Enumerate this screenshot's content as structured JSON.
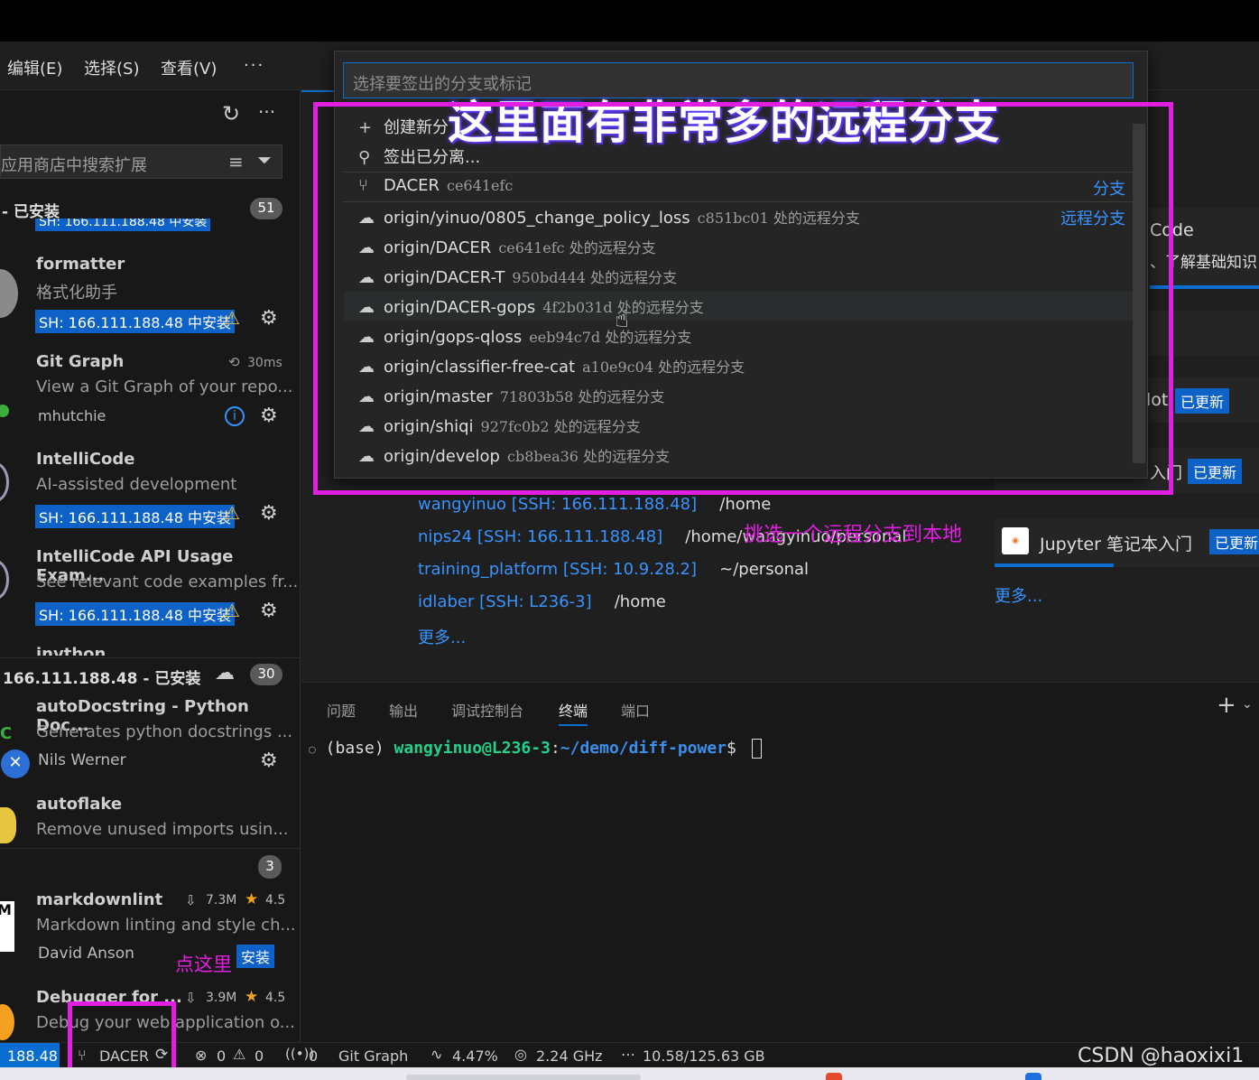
{
  "menu": {
    "edit": "编辑(E)",
    "select": "选择(S)",
    "view": "查看(V)",
    "more": "···"
  },
  "sidebar": {
    "search_placeholder": "应用商店中搜索扩展",
    "installed_header": "- 已安装",
    "installed_count": "51",
    "cut_item_text": "SH: 166.111.188.48 中安装",
    "installed_items": [
      {
        "name": "formatter",
        "desc": "格式化助手",
        "badge": "SH: 166.111.188.48 中安装"
      },
      {
        "name": "Git Graph",
        "desc": "View a Git Graph of your repo...",
        "publisher": "mhutchie",
        "time": "30ms"
      },
      {
        "name": "IntelliCode",
        "desc": "AI-assisted development",
        "badge": "SH: 166.111.188.48 中安装"
      },
      {
        "name": "IntelliCode API Usage Exam...",
        "desc": "See relevant code examples fr...",
        "badge": "SH: 166.111.188.48 中安装"
      },
      {
        "name": "invthon"
      }
    ],
    "remote_header": "166.111.188.48 - 已安装",
    "remote_count": "30",
    "remote_items": [
      {
        "name": "autoDocstring - Python Doc...",
        "desc": "Generates python docstrings ...",
        "publisher": "Nils Werner"
      },
      {
        "name": "autoflake",
        "desc": "Remove unused imports usin..."
      }
    ],
    "recommended_count": "3",
    "recommended_items": [
      {
        "name": "markdownlint",
        "downloads": "7.3M",
        "rating": "4.5",
        "desc": "Markdown linting and style ch...",
        "publisher": "David Anson",
        "install": "安装"
      },
      {
        "name": "Debugger for ...",
        "downloads": "3.9M",
        "rating": "4.5",
        "desc": "Debug your web application o..."
      }
    ]
  },
  "quickpick": {
    "placeholder": "选择要签出的分支或标记",
    "items": [
      {
        "icon": "+",
        "label": "创建新分",
        "desc": ""
      },
      {
        "icon": "⚲",
        "label": "签出已分离...",
        "desc": ""
      },
      {
        "icon": "⑂",
        "label": "DACER",
        "desc": "ce641efc",
        "tag": "分支"
      },
      {
        "icon": "☁",
        "label": "origin/yinuo/0805_change_policy_loss",
        "desc": "c851bc01 处的远程分支",
        "tag": "远程分支"
      },
      {
        "icon": "☁",
        "label": "origin/DACER",
        "desc": "ce641efc 处的远程分支"
      },
      {
        "icon": "☁",
        "label": "origin/DACER-T",
        "desc": "950bd444 处的远程分支"
      },
      {
        "icon": "☁",
        "label": "origin/DACER-gops",
        "desc": "4f2b031d 处的远程分支"
      },
      {
        "icon": "☁",
        "label": "origin/gops-qloss",
        "desc": "eeb94c7d 处的远程分支"
      },
      {
        "icon": "☁",
        "label": "origin/classifier-free-cat",
        "desc": "a10e9c04 处的远程分支"
      },
      {
        "icon": "☁",
        "label": "origin/master",
        "desc": "71803b58 处的远程分支"
      },
      {
        "icon": "☁",
        "label": "origin/shiqi",
        "desc": "927fc0b2 处的远程分支"
      },
      {
        "icon": "☁",
        "label": "origin/develop",
        "desc": "cb8bea36 处的远程分支"
      }
    ]
  },
  "annotations": {
    "title": "这里面有非常多的远程分支",
    "pick": "挑选一个远程分支到本地",
    "click_here": "点这里"
  },
  "welcome": {
    "recent": [
      {
        "name": "wangyinuo [SSH: 166.111.188.48]",
        "path": "/home"
      },
      {
        "name": "nips24 [SSH: 166.111.188.48]",
        "path": "/home/wangyinuo/personal"
      },
      {
        "name": "training_platform [SSH: 10.9.28.2]",
        "path": "~/personal"
      },
      {
        "name": "idlaber [SSH: L236-3]",
        "path": "/home"
      }
    ],
    "more": "更多...",
    "right_code": "Code",
    "right_basics": "、了解基础知识",
    "right_lot": "lot",
    "updated": "已更新",
    "right_intro": "入门",
    "jupyter": "Jupyter 笔记本入门",
    "right_more": "更多..."
  },
  "panel": {
    "tabs": [
      "问题",
      "输出",
      "调试控制台",
      "终端",
      "端口"
    ],
    "active_tab": "终端",
    "prompt_env": "(base)",
    "prompt_user": "wangyinuo@L236-3",
    "prompt_path": "~/demo/diff-power",
    "prompt_end": "$"
  },
  "statusbar": {
    "host": "188.48",
    "branch": "DACER",
    "errors": "0",
    "warnings": "0",
    "ports": "0",
    "git_graph": "Git Graph",
    "cpu": "4.47%",
    "freq": "2.24 GHz",
    "mem": "10.58/125.63 GB",
    "watermark": "CSDN @haoxixi1"
  },
  "colors": {
    "highlight": "#e21ee0",
    "accent": "#0a6ed1",
    "link": "#3794ff"
  }
}
